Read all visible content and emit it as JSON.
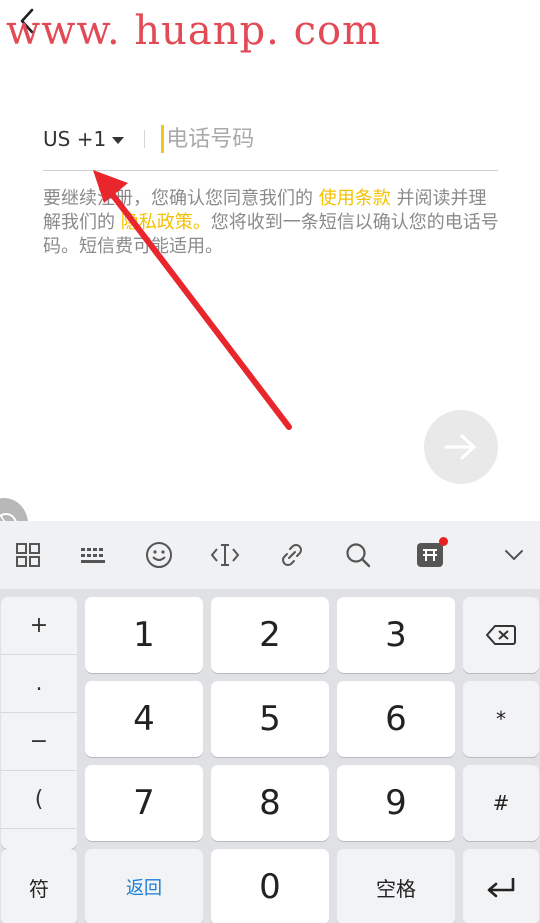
{
  "watermark": "www. huanp. com",
  "phone": {
    "country_code": "US +1",
    "placeholder": "电话号码"
  },
  "terms": {
    "part1": "要继续注册，您确认您同意我们的 ",
    "terms_link": "使用条款",
    "part2": " 并阅读并理解我们的 ",
    "privacy_link": "隐私政策。",
    "part3": "您将收到一条短信以确认您的电话号码。短信费可能适用。"
  },
  "keyboard": {
    "toolbar_icons": [
      "grid-icon",
      "keyboard-icon",
      "emoji-icon",
      "cursor-move-icon",
      "link-icon",
      "search-icon",
      "app-icon",
      "collapse-icon"
    ],
    "symbols": [
      "+",
      ".",
      "−",
      "("
    ],
    "digits": [
      "1",
      "2",
      "3",
      "4",
      "5",
      "6",
      "7",
      "8",
      "9",
      "0"
    ],
    "star": "*",
    "hash": "#",
    "fu_label": "符",
    "back_label": "返回",
    "space_label": "空格",
    "accent_blue": "#1a7fd6",
    "link_yellow": "#f2c200",
    "watermark_red": "#e24a55",
    "arrow_red": "#e8262b"
  }
}
